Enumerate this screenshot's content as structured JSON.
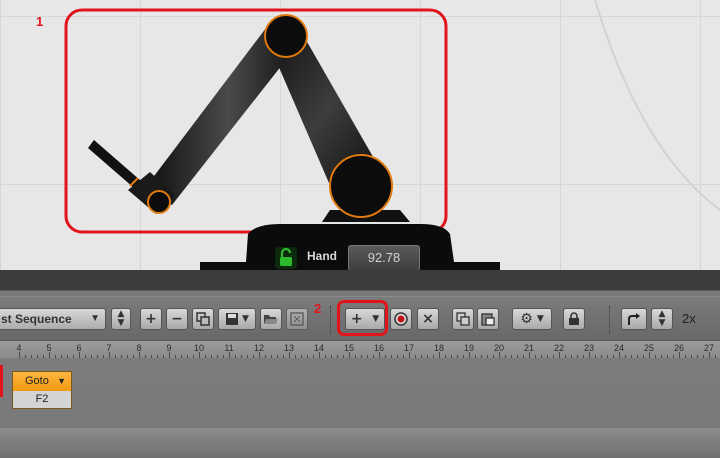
{
  "annotations": {
    "region_1_number": "1",
    "region_2_number": "2",
    "highlight_color": "#e0151c"
  },
  "robot_view": {
    "hand": {
      "label": "Hand",
      "value": "92.78",
      "lock_state": "unlocked",
      "lock_icon": "lock-open-icon",
      "lock_color": "#2cbb2c"
    }
  },
  "toolbar": {
    "sequence_select": {
      "value": "st Sequence"
    },
    "buttons": {
      "spin_updown": "updown-spinner-icon",
      "add": "+",
      "remove": "−",
      "duplicate": "duplicate-icon",
      "save": "save-icon",
      "open": "folder-open-icon",
      "export": "export-icon",
      "add_step": "+",
      "add_step_menu": "chevron-down-icon",
      "record": "record-icon",
      "delete": "×",
      "copy": "copy-icon",
      "paste": "paste-icon",
      "settings": "gear-icon",
      "lock": "lock-icon",
      "redo": "redo-arrow-icon",
      "speed_spinner": "updown-spinner-icon"
    },
    "speed_label": "2x"
  },
  "timeline": {
    "ticks": [
      "4",
      "5",
      "6",
      "7",
      "8",
      "9",
      "10",
      "11",
      "12",
      "13",
      "14",
      "15",
      "16",
      "17",
      "18",
      "19",
      "20",
      "21",
      "22",
      "23",
      "24",
      "25",
      "26",
      "27"
    ],
    "blocks": [
      {
        "title": "Goto",
        "param": "F2",
        "color": "#f5a623"
      }
    ]
  }
}
